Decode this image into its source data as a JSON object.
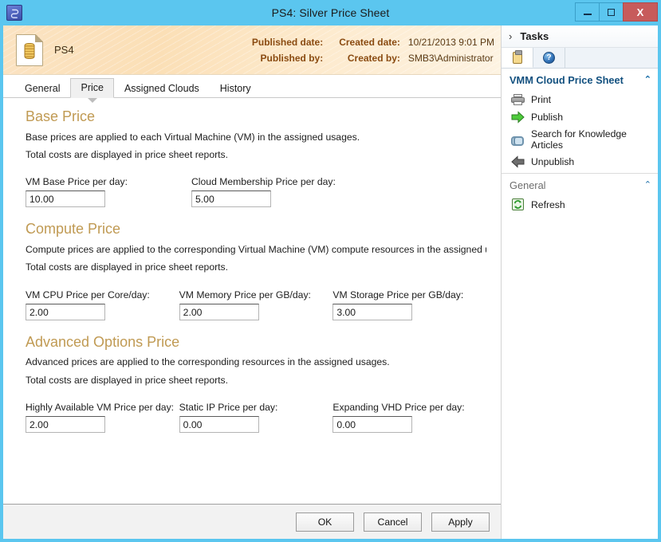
{
  "window": {
    "title": "PS4: Silver Price Sheet",
    "app_icon": "vmm-app-icon",
    "minimize_label": "Minimize",
    "maximize_label": "Maximize",
    "close_label": "X"
  },
  "banner": {
    "icon": "price-sheet-document-icon",
    "object_name": "PS4",
    "fields": [
      {
        "label": "Published date:",
        "value": ""
      },
      {
        "label": "Created date:",
        "value": "10/21/2013 9:01 PM"
      },
      {
        "label": "Published by:",
        "value": ""
      },
      {
        "label": "Created by:",
        "value": "SMB3\\Administrator"
      }
    ]
  },
  "tabs": [
    {
      "label": "General",
      "active": false
    },
    {
      "label": "Price",
      "active": true
    },
    {
      "label": "Assigned Clouds",
      "active": false
    },
    {
      "label": "History",
      "active": false
    }
  ],
  "sections": [
    {
      "title": "Base Price",
      "desc1": "Base prices are applied to each Virtual Machine (VM) in the assigned usages.",
      "desc2": "Total costs are displayed in price sheet reports.",
      "fields": [
        {
          "label": "VM Base Price per day:",
          "value": "10.00"
        },
        {
          "label": "Cloud Membership Price per day:",
          "value": "5.00"
        }
      ]
    },
    {
      "title": "Compute Price",
      "desc1": "Compute prices are applied to the corresponding Virtual Machine (VM) compute resources in the assigned usa...",
      "desc2": "Total costs are displayed in price sheet reports.",
      "fields": [
        {
          "label": "VM CPU Price per Core/day:",
          "value": "2.00"
        },
        {
          "label": "VM Memory Price per GB/day:",
          "value": "2.00"
        },
        {
          "label": "VM Storage Price per GB/day:",
          "value": "3.00"
        }
      ]
    },
    {
      "title": "Advanced Options Price",
      "desc1": "Advanced prices are applied to the corresponding resources in the assigned usages.",
      "desc2": "Total costs are displayed in price sheet reports.",
      "fields": [
        {
          "label": "Highly Available VM Price per day:",
          "value": "2.00"
        },
        {
          "label": "Static IP Price per day:",
          "value": "0.00"
        },
        {
          "label": "Expanding VHD Price per day:",
          "value": "0.00"
        }
      ]
    }
  ],
  "footer": {
    "ok": "OK",
    "cancel": "Cancel",
    "apply": "Apply"
  },
  "sidebar": {
    "header_title": "Tasks",
    "header_chevron": "›",
    "tabs": [
      {
        "icon": "clipboard-icon",
        "active": true
      },
      {
        "icon": "help-icon",
        "active": false
      }
    ],
    "groups": [
      {
        "title": "VMM Cloud Price Sheet",
        "caret": "⌃",
        "items": [
          {
            "label": "Print",
            "icon": "printer-icon"
          },
          {
            "label": "Publish",
            "icon": "publish-arrow-right-icon"
          },
          {
            "label": "Search for Knowledge Articles",
            "icon": "link-chain-icon"
          },
          {
            "label": "Unpublish",
            "icon": "unpublish-arrow-left-icon"
          }
        ]
      },
      {
        "title": "General",
        "caret": "⌃",
        "items": [
          {
            "label": "Refresh",
            "icon": "refresh-icon"
          }
        ]
      }
    ]
  },
  "colors": {
    "title_bar": "#5bc6ef",
    "close_button": "#c75b5b",
    "banner_gradient_start": "#fbe3c2",
    "section_title": "#c09a53",
    "sidebar_group_primary": "#12507f",
    "publish_arrow": "#3cb43c",
    "unpublish_arrow": "#555555"
  }
}
